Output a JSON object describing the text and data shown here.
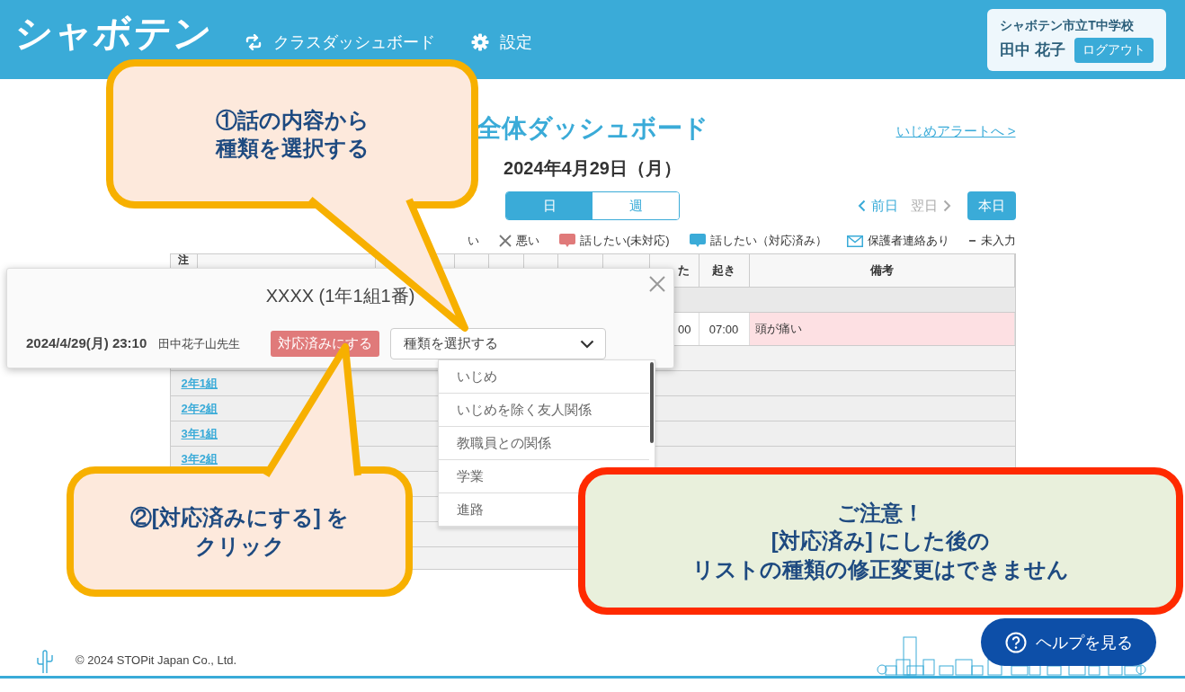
{
  "header": {
    "logo": "シャボテン",
    "nav": [
      {
        "kind": "dashboard",
        "label": "クラスダッシュボード"
      },
      {
        "kind": "settings",
        "label": "設定"
      }
    ],
    "user": {
      "school": "シャボテン市立T中学校",
      "name": "田中 花子",
      "logout": "ログアウト"
    }
  },
  "dashboard": {
    "title": "全体ダッシュボード",
    "alert_link": "いじめアラートへ >",
    "date": "2024年4月29日（月）",
    "view_tabs": [
      {
        "label": "日",
        "selected": true
      },
      {
        "label": "週",
        "selected": false
      }
    ],
    "prev": {
      "label": "前日",
      "disabled": false
    },
    "next": {
      "label": "翌日",
      "disabled": true
    },
    "today": "本日",
    "legend": [
      {
        "kind": "none",
        "label": "い"
      },
      {
        "kind": "cross",
        "label": "悪い"
      },
      {
        "kind": "bubble",
        "color": "#e07a7a",
        "label": "話したい(未対応)"
      },
      {
        "kind": "bubble",
        "color": "#3aabd8",
        "label": "話したい（対応済み）"
      },
      {
        "kind": "mail",
        "label": "保護者連絡あり"
      },
      {
        "kind": "dash",
        "label": "未入力"
      }
    ],
    "table": {
      "columns": [
        "注",
        "た",
        "起き",
        "備考"
      ],
      "rows": [
        {
          "kind": "group"
        },
        {
          "kind": "student",
          "flagged": true,
          "cells": [
            "00",
            "07:00",
            "頭が痛い"
          ]
        },
        {
          "kind": "blank"
        },
        {
          "kind": "class",
          "label": "2年1組"
        },
        {
          "kind": "class",
          "label": "2年2組"
        },
        {
          "kind": "class",
          "label": "3年1組"
        },
        {
          "kind": "class",
          "label": "3年2組"
        },
        {
          "kind": "blank"
        },
        {
          "kind": "blank"
        },
        {
          "kind": "blank"
        },
        {
          "kind": "blank"
        }
      ]
    }
  },
  "popup": {
    "title": "XXXX (1年1組1番)",
    "datetime": "2024/4/29(月) 23:10",
    "teacher": "田中花子山先生",
    "resolve_button": "対応済みにする",
    "select": {
      "placeholder": "種類を選択する",
      "expanded": true,
      "options": [
        "いじめ",
        "いじめを除く友人関係",
        "教職員との関係",
        "学業",
        "進路"
      ]
    }
  },
  "callouts": [
    {
      "kind": "step",
      "lines": [
        "①話の内容から",
        "種類を選択する"
      ]
    },
    {
      "kind": "step",
      "lines": [
        "②[対応済みにする] を",
        "クリック"
      ]
    },
    {
      "kind": "warning",
      "lines": [
        "ご注意！",
        "[対応済み] にした後の",
        "リストの種類の修正変更はできません"
      ]
    }
  ],
  "footer": {
    "copyright": "© 2024 STOPit Japan Co., Ltd.",
    "help_button": "ヘルプを見る"
  }
}
